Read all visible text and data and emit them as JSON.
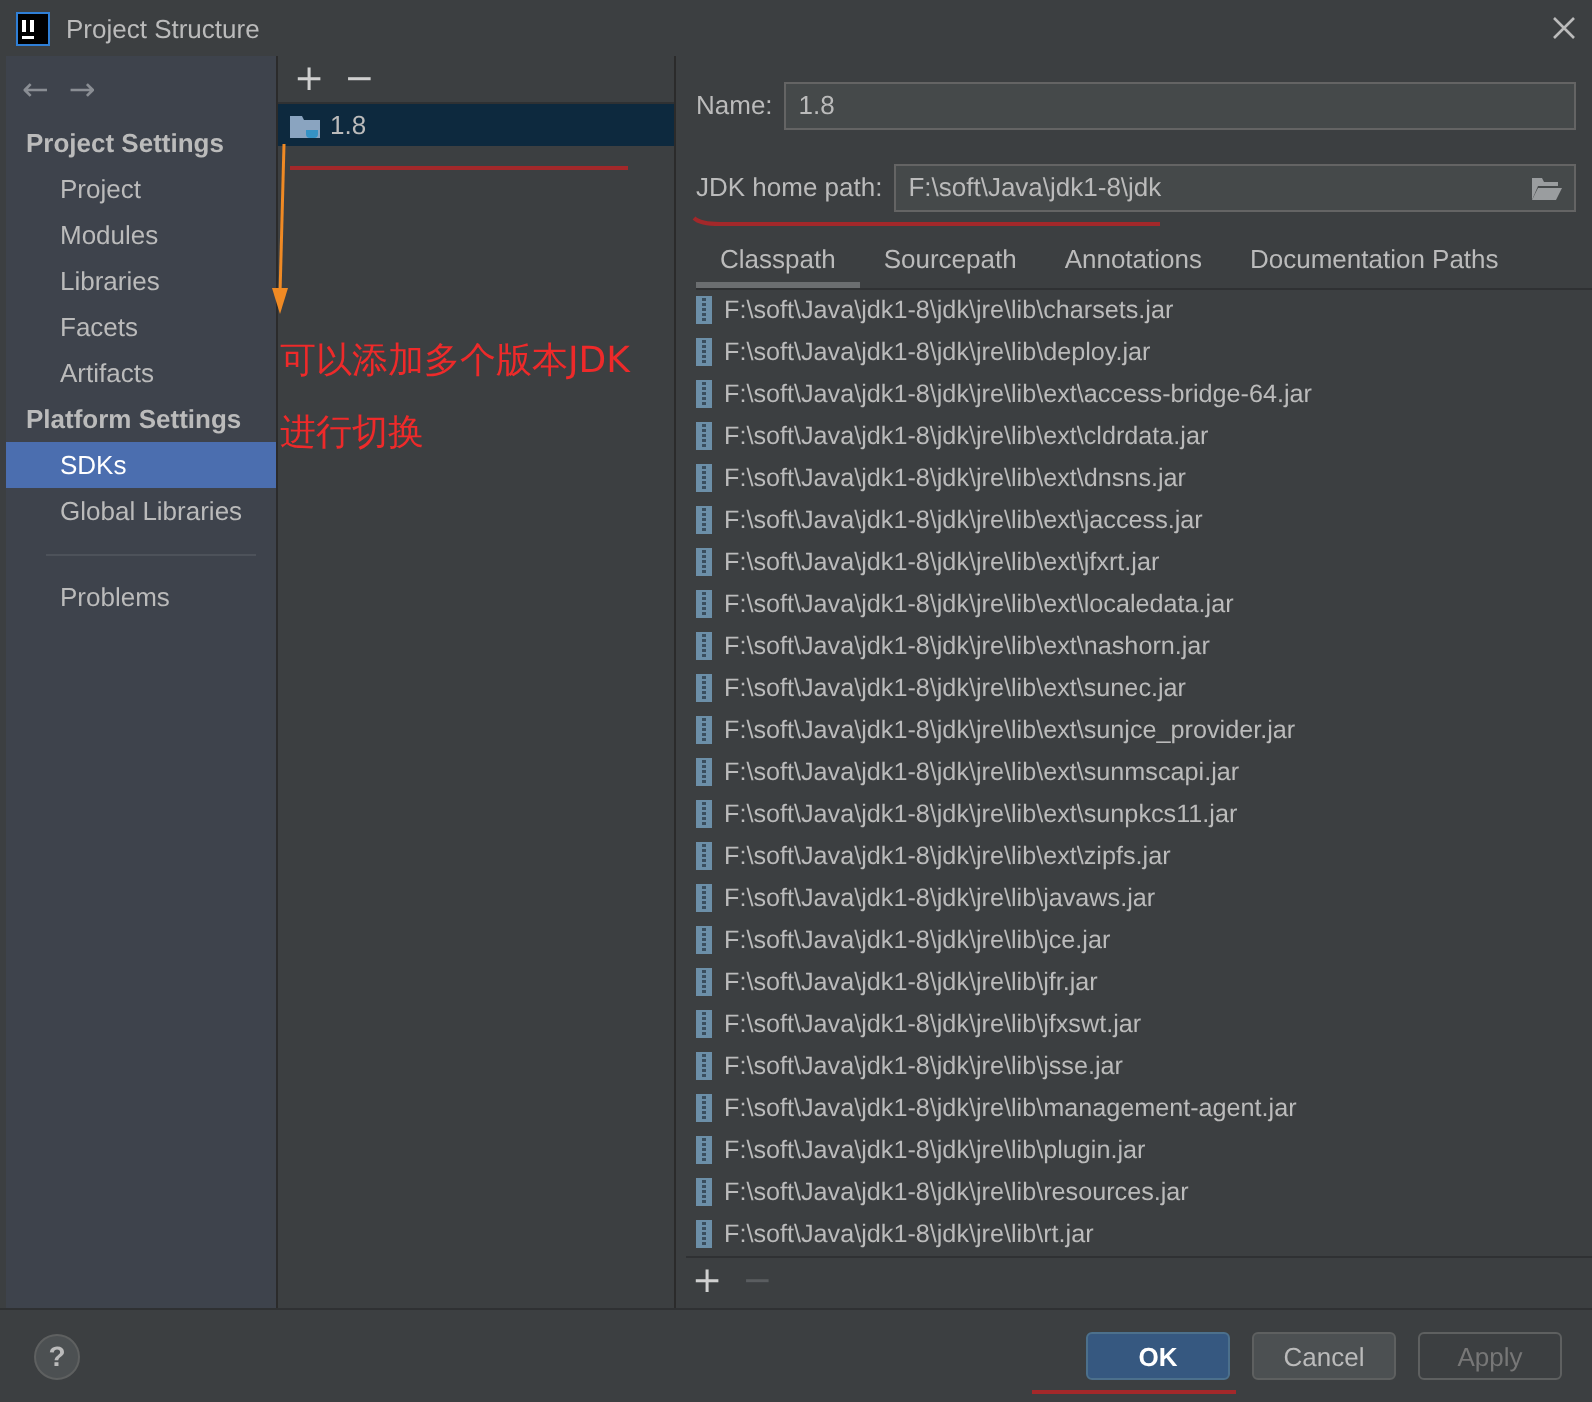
{
  "window": {
    "title": "Project Structure"
  },
  "sidebar": {
    "nav": [
      {
        "symbol": "←",
        "disabled": true
      },
      {
        "symbol": "→",
        "disabled": true
      }
    ],
    "sections": [
      {
        "heading": "Project Settings",
        "items": [
          {
            "label": "Project",
            "selected": false
          },
          {
            "label": "Modules",
            "selected": false
          },
          {
            "label": "Libraries",
            "selected": false
          },
          {
            "label": "Facets",
            "selected": false
          },
          {
            "label": "Artifacts",
            "selected": false
          }
        ]
      },
      {
        "heading": "Platform Settings",
        "items": [
          {
            "label": "SDKs",
            "selected": true
          },
          {
            "label": "Global Libraries",
            "selected": false
          }
        ]
      }
    ],
    "footer_items": [
      {
        "label": "Problems",
        "selected": false
      }
    ]
  },
  "sdk_list": {
    "toolbar": [
      {
        "symbol": "+",
        "disabled": false
      },
      {
        "symbol": "−",
        "disabled": false
      }
    ],
    "items": [
      {
        "label": "1.8",
        "selected": true
      }
    ]
  },
  "detail": {
    "name_label": "Name:",
    "name_value": "1.8",
    "home_label": "JDK home path:",
    "home_value": "F:\\soft\\Java\\jdk1-8\\jdk",
    "tabs": [
      {
        "label": "Classpath",
        "selected": true
      },
      {
        "label": "Sourcepath",
        "selected": false
      },
      {
        "label": "Annotations",
        "selected": false
      },
      {
        "label": "Documentation Paths",
        "selected": false
      }
    ],
    "classpath": [
      "F:\\soft\\Java\\jdk1-8\\jdk\\jre\\lib\\charsets.jar",
      "F:\\soft\\Java\\jdk1-8\\jdk\\jre\\lib\\deploy.jar",
      "F:\\soft\\Java\\jdk1-8\\jdk\\jre\\lib\\ext\\access-bridge-64.jar",
      "F:\\soft\\Java\\jdk1-8\\jdk\\jre\\lib\\ext\\cldrdata.jar",
      "F:\\soft\\Java\\jdk1-8\\jdk\\jre\\lib\\ext\\dnsns.jar",
      "F:\\soft\\Java\\jdk1-8\\jdk\\jre\\lib\\ext\\jaccess.jar",
      "F:\\soft\\Java\\jdk1-8\\jdk\\jre\\lib\\ext\\jfxrt.jar",
      "F:\\soft\\Java\\jdk1-8\\jdk\\jre\\lib\\ext\\localedata.jar",
      "F:\\soft\\Java\\jdk1-8\\jdk\\jre\\lib\\ext\\nashorn.jar",
      "F:\\soft\\Java\\jdk1-8\\jdk\\jre\\lib\\ext\\sunec.jar",
      "F:\\soft\\Java\\jdk1-8\\jdk\\jre\\lib\\ext\\sunjce_provider.jar",
      "F:\\soft\\Java\\jdk1-8\\jdk\\jre\\lib\\ext\\sunmscapi.jar",
      "F:\\soft\\Java\\jdk1-8\\jdk\\jre\\lib\\ext\\sunpkcs11.jar",
      "F:\\soft\\Java\\jdk1-8\\jdk\\jre\\lib\\ext\\zipfs.jar",
      "F:\\soft\\Java\\jdk1-8\\jdk\\jre\\lib\\javaws.jar",
      "F:\\soft\\Java\\jdk1-8\\jdk\\jre\\lib\\jce.jar",
      "F:\\soft\\Java\\jdk1-8\\jdk\\jre\\lib\\jfr.jar",
      "F:\\soft\\Java\\jdk1-8\\jdk\\jre\\lib\\jfxswt.jar",
      "F:\\soft\\Java\\jdk1-8\\jdk\\jre\\lib\\jsse.jar",
      "F:\\soft\\Java\\jdk1-8\\jdk\\jre\\lib\\management-agent.jar",
      "F:\\soft\\Java\\jdk1-8\\jdk\\jre\\lib\\plugin.jar",
      "F:\\soft\\Java\\jdk1-8\\jdk\\jre\\lib\\resources.jar",
      "F:\\soft\\Java\\jdk1-8\\jdk\\jre\\lib\\rt.jar"
    ],
    "toolbar": [
      {
        "symbol": "+",
        "disabled": false
      },
      {
        "symbol": "−",
        "disabled": true
      }
    ]
  },
  "footer": {
    "help": "?",
    "buttons": [
      {
        "label": "OK",
        "kind": "default"
      },
      {
        "label": "Cancel",
        "kind": "normal"
      },
      {
        "label": "Apply",
        "kind": "disabled"
      }
    ]
  },
  "annotations": [
    "可以添加多个版本JDK",
    "进行切换"
  ]
}
